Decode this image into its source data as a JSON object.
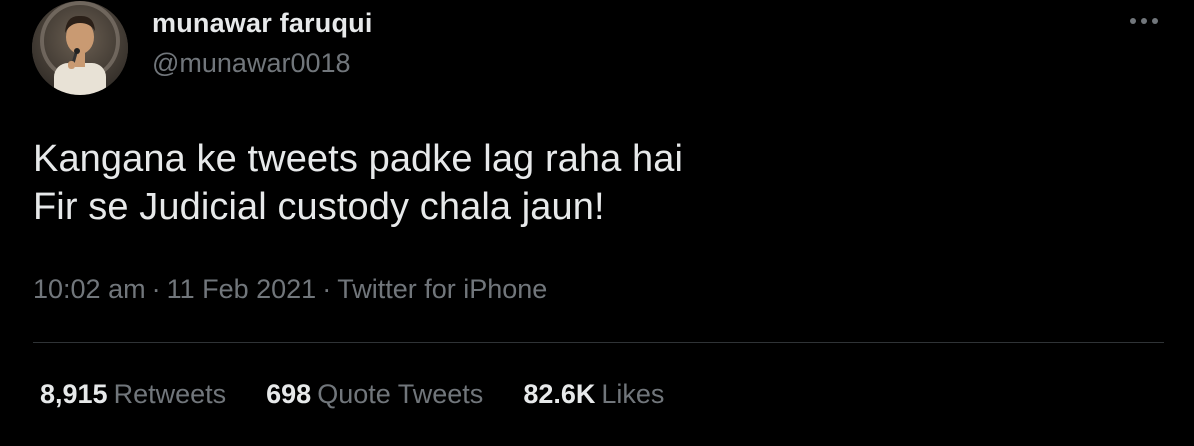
{
  "author": {
    "name": "munawar faruqui",
    "handle": "@munawar0018"
  },
  "tweet": {
    "lines": [
      "Kangana ke tweets padke lag raha hai",
      "Fir se Judicial custody chala jaun!"
    ]
  },
  "meta": {
    "time": "10:02 am",
    "date": "11 Feb 2021",
    "separator": "·",
    "source": "Twitter for iPhone"
  },
  "stats": {
    "retweets_count": "8,915",
    "retweets_label": "Retweets",
    "quotes_count": "698",
    "quotes_label": "Quote Tweets",
    "likes_count": "82.6K",
    "likes_label": "Likes"
  },
  "icons": {
    "more": "more-horizontal-icon"
  },
  "colors": {
    "background": "#000000",
    "primary_text": "#e7e9ea",
    "secondary_text": "#71767b",
    "divider": "#2f3336"
  }
}
